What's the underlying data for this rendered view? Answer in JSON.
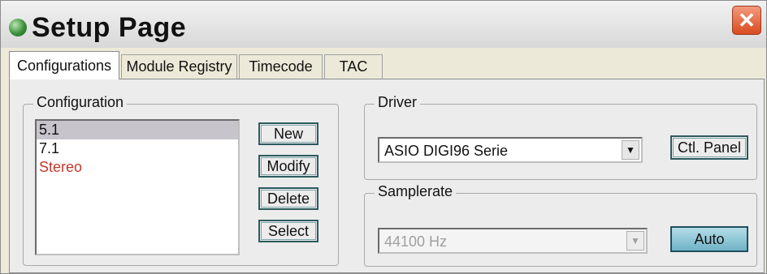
{
  "window": {
    "title": "Setup Page",
    "close_glyph": "✕",
    "app_icon": "green-orb-icon",
    "close_color": "#d94a20"
  },
  "tabs": [
    {
      "label": "Configurations",
      "active": true
    },
    {
      "label": "Module Registry",
      "active": false
    },
    {
      "label": "Timecode",
      "active": false
    },
    {
      "label": "TAC",
      "active": false
    }
  ],
  "configuration": {
    "group_label": "Configuration",
    "items": [
      {
        "label": "5.1",
        "selected": true
      },
      {
        "label": "7.1",
        "selected": false
      },
      {
        "label": "Stereo",
        "selected": false,
        "color": "#c0392b"
      }
    ],
    "buttons": {
      "new": "New",
      "modify": "Modify",
      "delete": "Delete",
      "select": "Select"
    }
  },
  "driver": {
    "group_label": "Driver",
    "selected": "ASIO DIGI96 Serie",
    "panel_button": "Ctl. Panel"
  },
  "samplerate": {
    "group_label": "Samplerate",
    "selected": "44100 Hz",
    "disabled": true,
    "auto_button": "Auto"
  }
}
